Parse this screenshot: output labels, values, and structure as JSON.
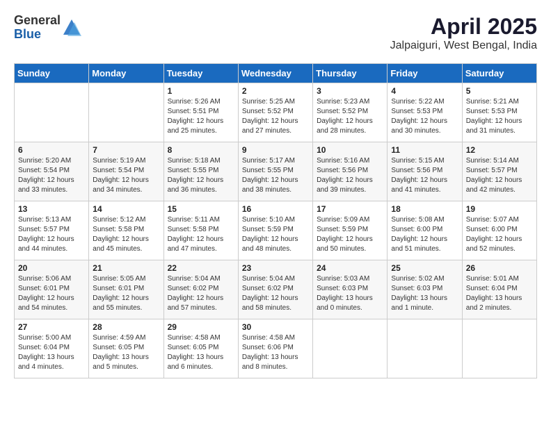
{
  "header": {
    "logo_general": "General",
    "logo_blue": "Blue",
    "month": "April 2025",
    "location": "Jalpaiguri, West Bengal, India"
  },
  "weekdays": [
    "Sunday",
    "Monday",
    "Tuesday",
    "Wednesday",
    "Thursday",
    "Friday",
    "Saturday"
  ],
  "weeks": [
    [
      {
        "day": "",
        "detail": ""
      },
      {
        "day": "",
        "detail": ""
      },
      {
        "day": "1",
        "detail": "Sunrise: 5:26 AM\nSunset: 5:51 PM\nDaylight: 12 hours\nand 25 minutes."
      },
      {
        "day": "2",
        "detail": "Sunrise: 5:25 AM\nSunset: 5:52 PM\nDaylight: 12 hours\nand 27 minutes."
      },
      {
        "day": "3",
        "detail": "Sunrise: 5:23 AM\nSunset: 5:52 PM\nDaylight: 12 hours\nand 28 minutes."
      },
      {
        "day": "4",
        "detail": "Sunrise: 5:22 AM\nSunset: 5:53 PM\nDaylight: 12 hours\nand 30 minutes."
      },
      {
        "day": "5",
        "detail": "Sunrise: 5:21 AM\nSunset: 5:53 PM\nDaylight: 12 hours\nand 31 minutes."
      }
    ],
    [
      {
        "day": "6",
        "detail": "Sunrise: 5:20 AM\nSunset: 5:54 PM\nDaylight: 12 hours\nand 33 minutes."
      },
      {
        "day": "7",
        "detail": "Sunrise: 5:19 AM\nSunset: 5:54 PM\nDaylight: 12 hours\nand 34 minutes."
      },
      {
        "day": "8",
        "detail": "Sunrise: 5:18 AM\nSunset: 5:55 PM\nDaylight: 12 hours\nand 36 minutes."
      },
      {
        "day": "9",
        "detail": "Sunrise: 5:17 AM\nSunset: 5:55 PM\nDaylight: 12 hours\nand 38 minutes."
      },
      {
        "day": "10",
        "detail": "Sunrise: 5:16 AM\nSunset: 5:56 PM\nDaylight: 12 hours\nand 39 minutes."
      },
      {
        "day": "11",
        "detail": "Sunrise: 5:15 AM\nSunset: 5:56 PM\nDaylight: 12 hours\nand 41 minutes."
      },
      {
        "day": "12",
        "detail": "Sunrise: 5:14 AM\nSunset: 5:57 PM\nDaylight: 12 hours\nand 42 minutes."
      }
    ],
    [
      {
        "day": "13",
        "detail": "Sunrise: 5:13 AM\nSunset: 5:57 PM\nDaylight: 12 hours\nand 44 minutes."
      },
      {
        "day": "14",
        "detail": "Sunrise: 5:12 AM\nSunset: 5:58 PM\nDaylight: 12 hours\nand 45 minutes."
      },
      {
        "day": "15",
        "detail": "Sunrise: 5:11 AM\nSunset: 5:58 PM\nDaylight: 12 hours\nand 47 minutes."
      },
      {
        "day": "16",
        "detail": "Sunrise: 5:10 AM\nSunset: 5:59 PM\nDaylight: 12 hours\nand 48 minutes."
      },
      {
        "day": "17",
        "detail": "Sunrise: 5:09 AM\nSunset: 5:59 PM\nDaylight: 12 hours\nand 50 minutes."
      },
      {
        "day": "18",
        "detail": "Sunrise: 5:08 AM\nSunset: 6:00 PM\nDaylight: 12 hours\nand 51 minutes."
      },
      {
        "day": "19",
        "detail": "Sunrise: 5:07 AM\nSunset: 6:00 PM\nDaylight: 12 hours\nand 52 minutes."
      }
    ],
    [
      {
        "day": "20",
        "detail": "Sunrise: 5:06 AM\nSunset: 6:01 PM\nDaylight: 12 hours\nand 54 minutes."
      },
      {
        "day": "21",
        "detail": "Sunrise: 5:05 AM\nSunset: 6:01 PM\nDaylight: 12 hours\nand 55 minutes."
      },
      {
        "day": "22",
        "detail": "Sunrise: 5:04 AM\nSunset: 6:02 PM\nDaylight: 12 hours\nand 57 minutes."
      },
      {
        "day": "23",
        "detail": "Sunrise: 5:04 AM\nSunset: 6:02 PM\nDaylight: 12 hours\nand 58 minutes."
      },
      {
        "day": "24",
        "detail": "Sunrise: 5:03 AM\nSunset: 6:03 PM\nDaylight: 13 hours\nand 0 minutes."
      },
      {
        "day": "25",
        "detail": "Sunrise: 5:02 AM\nSunset: 6:03 PM\nDaylight: 13 hours\nand 1 minute."
      },
      {
        "day": "26",
        "detail": "Sunrise: 5:01 AM\nSunset: 6:04 PM\nDaylight: 13 hours\nand 2 minutes."
      }
    ],
    [
      {
        "day": "27",
        "detail": "Sunrise: 5:00 AM\nSunset: 6:04 PM\nDaylight: 13 hours\nand 4 minutes."
      },
      {
        "day": "28",
        "detail": "Sunrise: 4:59 AM\nSunset: 6:05 PM\nDaylight: 13 hours\nand 5 minutes."
      },
      {
        "day": "29",
        "detail": "Sunrise: 4:58 AM\nSunset: 6:05 PM\nDaylight: 13 hours\nand 6 minutes."
      },
      {
        "day": "30",
        "detail": "Sunrise: 4:58 AM\nSunset: 6:06 PM\nDaylight: 13 hours\nand 8 minutes."
      },
      {
        "day": "",
        "detail": ""
      },
      {
        "day": "",
        "detail": ""
      },
      {
        "day": "",
        "detail": ""
      }
    ]
  ]
}
